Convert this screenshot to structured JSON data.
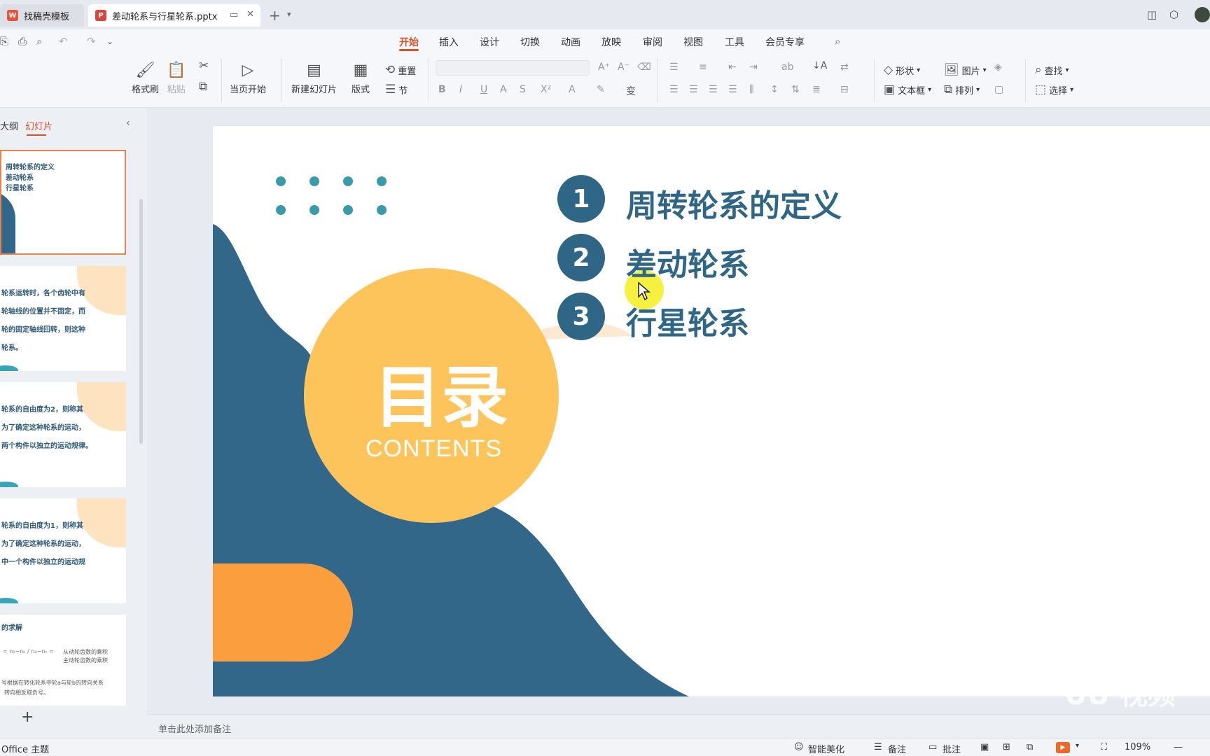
{
  "tabs": [
    {
      "label": "找稿壳模板",
      "icon": "wps-icon"
    },
    {
      "label": "差动轮系与行星轮系.pptx",
      "icon": "ppt-icon"
    }
  ],
  "menu": [
    "开始",
    "插入",
    "设计",
    "切换",
    "动画",
    "放映",
    "审阅",
    "视图",
    "工具",
    "会员专享"
  ],
  "active_menu": "开始",
  "ribbon": {
    "format_painter": "格式刷",
    "paste": "粘贴",
    "from_current": "当页开始",
    "new_slide": "新建幻灯片",
    "layout": "版式",
    "reset": "重置",
    "section": "节",
    "shape": "形状",
    "picture": "图片",
    "textbox": "文本框",
    "arrange": "排列",
    "find": "查找",
    "select": "选择"
  },
  "left_panel": {
    "outline_tab": "大纲",
    "slides_tab": "幻灯片",
    "thumbs": [
      {
        "lines": [
          "周转轮系的定义",
          "差动轮系",
          "行星轮系"
        ]
      },
      {
        "lines": [
          "轮系运转时，各个齿轮中有",
          "轮轴线的位置并不固定，而",
          "轮的固定轴线回转，则这种",
          "轮系。"
        ]
      },
      {
        "lines": [
          "轮系的自由度为2，则称其",
          "为了确定这种轮系的运动，",
          "两个构件以独立的运动规律。"
        ]
      },
      {
        "lines": [
          "轮系的自由度为1，则称其",
          "为了确定这种轮系的运动，",
          "中一个构件以独立的运动规"
        ]
      },
      {
        "lines": [
          "的求解",
          "从动轮齿数的乘积",
          "主动轮齿数的乘积",
          "号根据在转化轮系中轮a与轮b的转向关系",
          "转向相反取负号。"
        ]
      }
    ],
    "add_button": "+"
  },
  "slide": {
    "items": [
      {
        "num": "1",
        "text": "周转轮系的定义"
      },
      {
        "num": "2",
        "text": "差动轮系"
      },
      {
        "num": "3",
        "text": "行星轮系"
      }
    ],
    "title": "目录",
    "subtitle": "CONTENTS",
    "colors": {
      "navy": "#33678a",
      "yellow": "#fdc45b",
      "orange": "#fb9f3e",
      "teal": "#3a9aa8"
    }
  },
  "notes_placeholder": "单击此处添加备注",
  "status": {
    "theme": "Office 主题",
    "beautify": "智能美化",
    "notes": "备注",
    "comments": "批注",
    "zoom": "109%"
  },
  "watermark": "UU 视频"
}
